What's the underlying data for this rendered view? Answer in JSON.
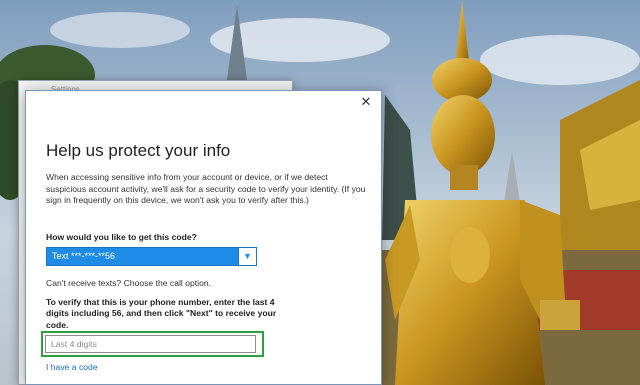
{
  "dialog": {
    "heading": "Help us protect your info",
    "description": "When accessing sensitive info from your account or device, or if we detect suspicious account activity, we'll ask for a security code to verify your identity. (If you sign in frequently on this device, we won't ask you to verify after this.)",
    "method_question": "How would you like to get this code?",
    "method_selected": "Text ***-***-**56",
    "call_hint": "Can't receive texts? Choose the call option.",
    "verify_instructions": "To verify that this is your phone number, enter the last 4 digits including 56, and then click \"Next\" to receive your code.",
    "digits_placeholder": "Last 4 digits",
    "digits_value": "",
    "have_code_link": "I have a code"
  },
  "colors": {
    "select_accent": "#1e8ce6",
    "highlight_border": "#2f9e44",
    "link": "#1a6fc2"
  }
}
